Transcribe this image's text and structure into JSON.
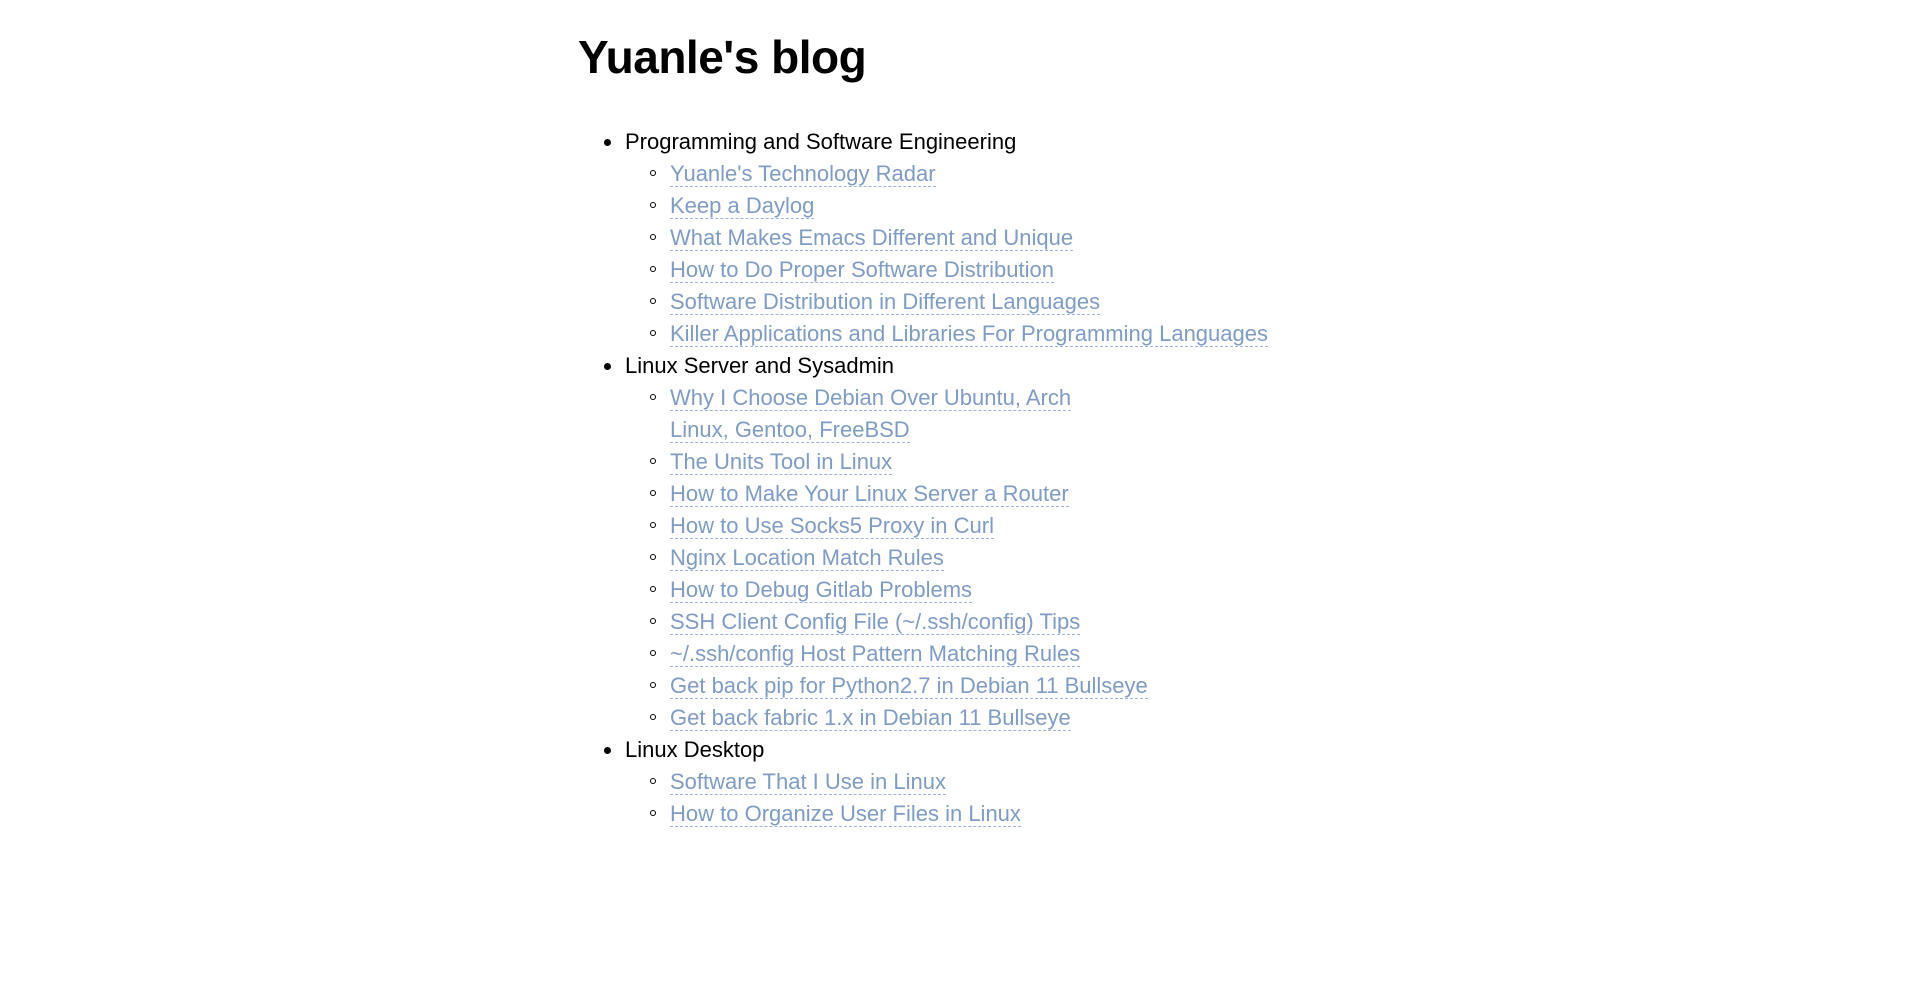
{
  "page": {
    "title": "Yuanle's blog",
    "background_color": "#ffffff",
    "text_color": "#000000",
    "link_color": "#7e9cc4",
    "link_underline_style": "dashed",
    "link_underline_color": "#9db4d2"
  },
  "sections": [
    {
      "label": "Programming and Software Engineering",
      "bullet": "disc-bullet",
      "entries": [
        {
          "label": "Yuanle's Technology Radar",
          "wraps": false
        },
        {
          "label": "Keep a Daylog",
          "wraps": false
        },
        {
          "label": "What Makes Emacs Different and Unique",
          "wraps": false
        },
        {
          "label": "How to Do Proper Software Distribution",
          "wraps": false
        },
        {
          "label": "Software Distribution in Different Languages",
          "wraps": false
        },
        {
          "label": "Killer Applications and Libraries For Programming Languages",
          "wraps": false
        }
      ]
    },
    {
      "label": "Linux Server and Sysadmin",
      "bullet": "disc-bullet",
      "entries": [
        {
          "label": "Why I Choose Debian Over Ubuntu, Arch Linux, Gentoo, FreeBSD",
          "wraps": true
        },
        {
          "label": "The Units Tool in Linux",
          "wraps": false
        },
        {
          "label": "How to Make Your Linux Server a Router",
          "wraps": false
        },
        {
          "label": "How to Use Socks5 Proxy in Curl",
          "wraps": false
        },
        {
          "label": "Nginx Location Match Rules",
          "wraps": false
        },
        {
          "label": "How to Debug Gitlab Problems",
          "wraps": false
        },
        {
          "label": "SSH Client Config File (~/.ssh/config) Tips",
          "wraps": false
        },
        {
          "label": "~/.ssh/config Host Pattern Matching Rules",
          "wraps": false
        },
        {
          "label": "Get back pip for Python2.7 in Debian 11 Bullseye",
          "wraps": false
        },
        {
          "label": "Get back fabric 1.x in Debian 11 Bullseye",
          "wraps": false
        }
      ]
    },
    {
      "label": "Linux Desktop",
      "bullet": "disc-bullet",
      "entries": [
        {
          "label": "Software That I Use in Linux",
          "wraps": false
        },
        {
          "label": "How to Organize User Files in Linux",
          "wraps": false
        }
      ]
    }
  ]
}
